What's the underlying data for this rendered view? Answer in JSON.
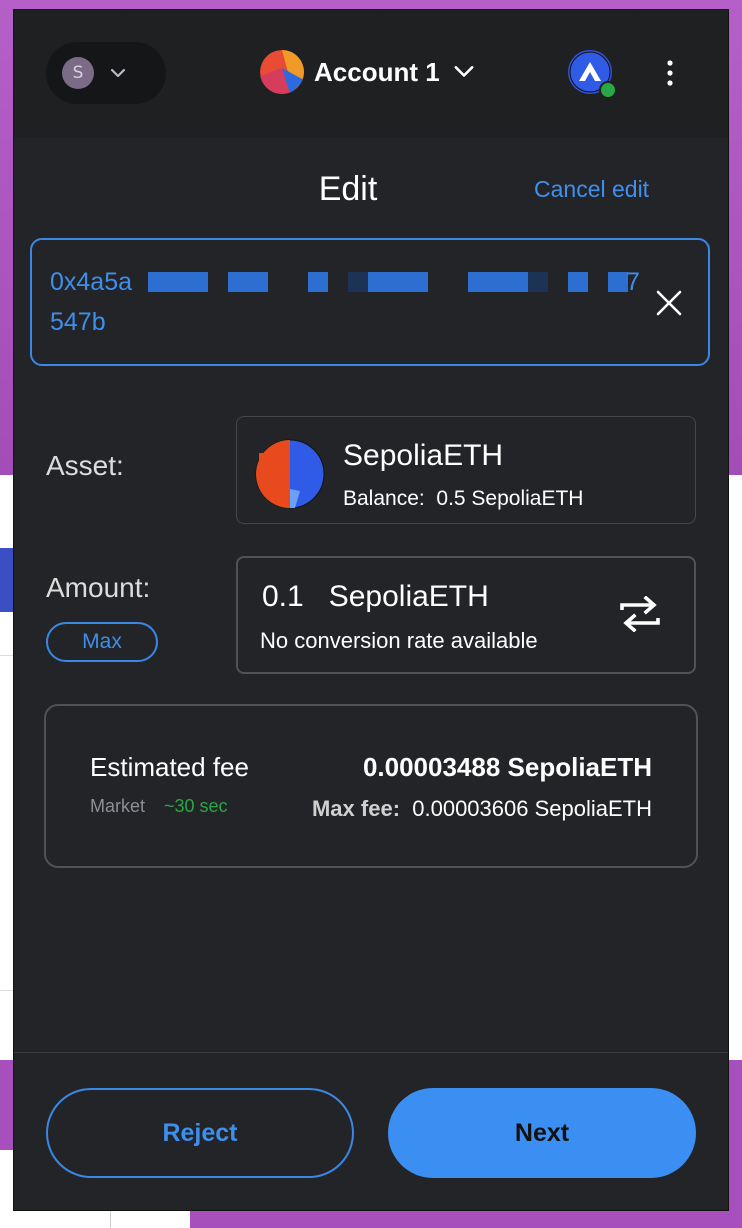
{
  "header": {
    "network_initial": "S",
    "account_name": "Account 1"
  },
  "edit": {
    "title": "Edit",
    "cancel_label": "Cancel edit"
  },
  "recipient": {
    "address_start": "0x4a5a",
    "address_end_line1": "7",
    "address_line2": "547b"
  },
  "asset": {
    "label": "Asset:",
    "name": "SepoliaETH",
    "balance": "Balance:  0.5 SepoliaETH"
  },
  "amount": {
    "label": "Amount:",
    "max_label": "Max",
    "value": "0.1   SepoliaETH",
    "conversion_note": "No conversion rate available"
  },
  "fee": {
    "label": "Estimated fee",
    "value": "0.00003488 SepoliaETH",
    "market_label": "Market",
    "time": "~30 sec",
    "max_fee_label": "Max fee:",
    "max_fee_value": "  0.00003606 SepoliaETH"
  },
  "footer": {
    "reject_label": "Reject",
    "next_label": "Next"
  },
  "colors": {
    "accent_blue": "#3b8ef2",
    "background": "#232427",
    "success_green": "#28a745"
  }
}
